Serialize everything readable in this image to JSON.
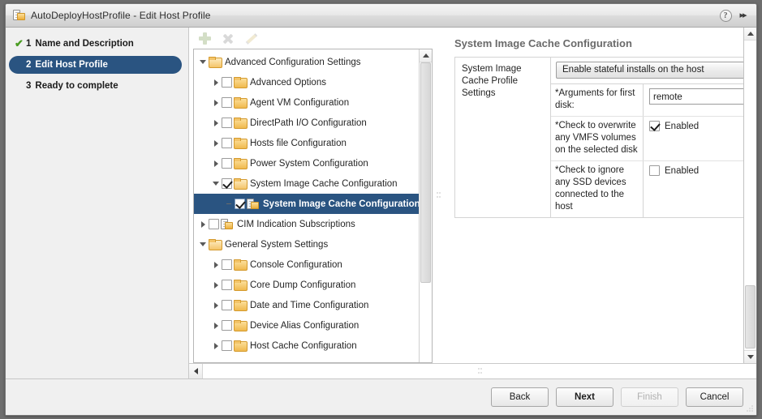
{
  "window": {
    "title": "AutoDeployHostProfile - Edit Host Profile",
    "icon": "host-profile-icon",
    "help_label": "?",
    "expand_label": "▸▸"
  },
  "sidebar": {
    "steps": [
      {
        "num": "1",
        "label": "Name and Description",
        "state": "complete",
        "check": "✔"
      },
      {
        "num": "2",
        "label": "Edit Host Profile",
        "state": "active",
        "check": ""
      },
      {
        "num": "3",
        "label": "Ready to complete",
        "state": "pending",
        "check": ""
      }
    ]
  },
  "toolbar": {
    "add_label": "add-icon",
    "delete_label": "delete-icon",
    "edit_label": "edit-icon"
  },
  "tree": {
    "nodes": [
      {
        "label": "Advanced Configuration Settings",
        "indent": 0,
        "twisty": "down",
        "checkbox": "none",
        "icon": "folder-open",
        "selected": false
      },
      {
        "label": "Advanced Options",
        "indent": 1,
        "twisty": "right",
        "checkbox": "off",
        "icon": "folder",
        "selected": false
      },
      {
        "label": "Agent VM Configuration",
        "indent": 1,
        "twisty": "right",
        "checkbox": "off",
        "icon": "folder",
        "selected": false
      },
      {
        "label": "DirectPath I/O Configuration",
        "indent": 1,
        "twisty": "right",
        "checkbox": "off",
        "icon": "folder",
        "selected": false
      },
      {
        "label": "Hosts file Configuration",
        "indent": 1,
        "twisty": "right",
        "checkbox": "off",
        "icon": "folder",
        "selected": false
      },
      {
        "label": "Power System Configuration",
        "indent": 1,
        "twisty": "right",
        "checkbox": "off",
        "icon": "folder",
        "selected": false
      },
      {
        "label": "System Image Cache Configuration",
        "indent": 1,
        "twisty": "down",
        "checkbox": "on",
        "icon": "folder-open",
        "selected": false
      },
      {
        "label": "System Image Cache Configuration",
        "indent": 2,
        "twisty": "dash",
        "checkbox": "on",
        "icon": "profile",
        "selected": true
      },
      {
        "label": "CIM Indication Subscriptions",
        "indent": 0,
        "twisty": "right",
        "checkbox": "off",
        "icon": "profile",
        "selected": false
      },
      {
        "label": "General System Settings",
        "indent": 0,
        "twisty": "down",
        "checkbox": "none",
        "icon": "folder-open",
        "selected": false
      },
      {
        "label": "Console Configuration",
        "indent": 1,
        "twisty": "right",
        "checkbox": "off",
        "icon": "folder",
        "selected": false
      },
      {
        "label": "Core Dump Configuration",
        "indent": 1,
        "twisty": "right",
        "checkbox": "off",
        "icon": "folder",
        "selected": false
      },
      {
        "label": "Date and Time Configuration",
        "indent": 1,
        "twisty": "right",
        "checkbox": "off",
        "icon": "folder",
        "selected": false
      },
      {
        "label": "Device Alias Configuration",
        "indent": 1,
        "twisty": "right",
        "checkbox": "off",
        "icon": "folder",
        "selected": false
      },
      {
        "label": "Host Cache Configuration",
        "indent": 1,
        "twisty": "right",
        "checkbox": "off",
        "icon": "folder",
        "selected": false
      }
    ]
  },
  "settings": {
    "section_title": "System Image Cache Configuration",
    "group_label": "System Image Cache Profile Settings",
    "policy": {
      "selected": "Enable stateful installs on the host"
    },
    "rows": [
      {
        "label": "*Arguments for first disk:",
        "type": "text",
        "value": "remote"
      },
      {
        "label": "*Check to overwrite any VMFS volumes on the selected disk",
        "type": "checkbox",
        "checked": true,
        "value": "Enabled"
      },
      {
        "label": "*Check to ignore any SSD devices connected to the host",
        "type": "checkbox",
        "checked": false,
        "value": "Enabled"
      }
    ]
  },
  "footer": {
    "back": "Back",
    "next": "Next",
    "finish": "Finish",
    "cancel": "Cancel"
  }
}
